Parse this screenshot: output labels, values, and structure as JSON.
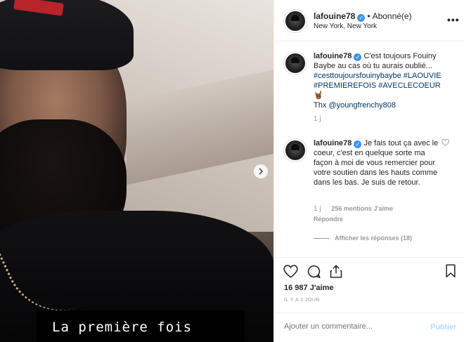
{
  "post": {
    "caption_overlay": "La première fois",
    "next_icon": "chevron-right-icon"
  },
  "header": {
    "username": "lafouine78",
    "verified_icon": "verified-badge-icon",
    "separator": "•",
    "follow_status": "Abonné(e)",
    "location": "New York, New York",
    "more_icon": "more-options-icon"
  },
  "comments": [
    {
      "username": "lafouine78",
      "text_plain": "C'est toujours Fouiny Baybe au cas où tu aurais oublié...",
      "hashtags": "#cesttoujoursfouinybaybe #LAOUVIE #PREMIEREFOIS #AVECLECOEUR",
      "emoji": "🤘🏾",
      "thanks_prefix": "Thx",
      "mention": "@youngfrenchy808",
      "time": "1 j"
    },
    {
      "username": "lafouine78",
      "text": "Je fais tout ça avec le coeur, c'est en quelque sorte ma façon à moi de vous remercier pour votre soutien dans les hauts comme dans les bas. Je suis de retour.",
      "time": "1 j",
      "likes": "256 mentions J'aime",
      "reply": "Répondre",
      "view_replies": "Afficher les réponses (18)"
    }
  ],
  "actions": {
    "like_icon": "heart-icon",
    "comment_icon": "comment-icon",
    "share_icon": "share-icon",
    "save_icon": "bookmark-icon",
    "likes_count": "16 987 J'aime",
    "time_ago": "IL Y A 1 JOUR"
  },
  "add_comment": {
    "placeholder": "Ajouter un commentaire...",
    "publish": "Publier"
  }
}
